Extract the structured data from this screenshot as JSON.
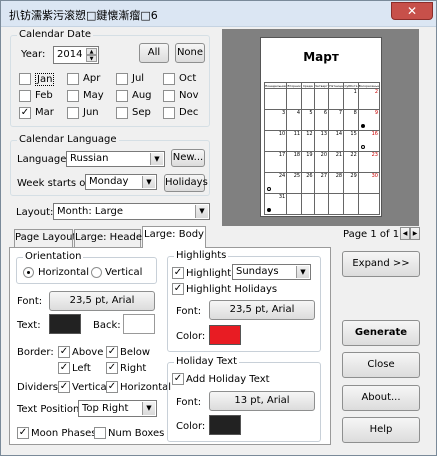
{
  "window": {
    "title": "扒钫濡紫污滚愬□鍵懐漸瘤□6",
    "close": "✕"
  },
  "calendar_date": {
    "group_label": "Calendar Date",
    "year_label": "Year:",
    "year_value": "2014",
    "all_label": "All",
    "none_label": "None",
    "months": [
      {
        "label": "Jan",
        "checked": false
      },
      {
        "label": "Apr",
        "checked": false
      },
      {
        "label": "Jul",
        "checked": false
      },
      {
        "label": "Oct",
        "checked": false
      },
      {
        "label": "Feb",
        "checked": false
      },
      {
        "label": "May",
        "checked": false
      },
      {
        "label": "Aug",
        "checked": false
      },
      {
        "label": "Nov",
        "checked": false
      },
      {
        "label": "Mar",
        "checked": true
      },
      {
        "label": "Jun",
        "checked": false
      },
      {
        "label": "Sep",
        "checked": false
      },
      {
        "label": "Dec",
        "checked": false
      }
    ]
  },
  "calendar_language": {
    "group_label": "Calendar Language",
    "language_label": "Language:",
    "language_value": "Russian",
    "new_label": "New...",
    "week_starts_label": "Week starts on:",
    "week_starts_value": "Monday",
    "holidays_label": "Holidays"
  },
  "layout": {
    "label": "Layout:",
    "value": "Month: Large"
  },
  "preview": {
    "month_title": "Март",
    "weekday_headers": [
      "Понедельник",
      "Вторник",
      "Среда",
      "Четверг",
      "Пятница",
      "Суббота",
      "Воскресенье"
    ],
    "weeks": [
      [
        "",
        "",
        "",
        "",
        "",
        "1",
        "2"
      ],
      [
        "3",
        "4",
        "5",
        "6",
        "7",
        "8",
        "9"
      ],
      [
        "10",
        "11",
        "12",
        "13",
        "14",
        "15",
        "16"
      ],
      [
        "17",
        "18",
        "19",
        "20",
        "21",
        "22",
        "23"
      ],
      [
        "24",
        "25",
        "26",
        "27",
        "28",
        "29",
        "30"
      ],
      [
        "31",
        "",
        "",
        "",
        "",
        "",
        ""
      ]
    ],
    "page_label": "Page 1 of 1",
    "prev_icon": "◀",
    "next_icon": "▶"
  },
  "tabs": [
    {
      "label": "Page Layout",
      "active": false
    },
    {
      "label": "Large: Header",
      "active": false
    },
    {
      "label": "Large: Body",
      "active": true
    }
  ],
  "orientation": {
    "group_label": "Orientation",
    "horizontal_label": "Horizontal",
    "vertical_label": "Vertical",
    "selected": "Horizontal"
  },
  "body": {
    "font_label": "Font:",
    "font_value": "23,5 pt, Arial",
    "text_label": "Text:",
    "text_color": "#222222",
    "back_label": "Back:",
    "back_color": "#ffffff",
    "border_label": "Border:",
    "border_above": "Above",
    "border_below": "Below",
    "border_left": "Left",
    "border_right": "Right",
    "dividers_label": "Dividers:",
    "dividers_vertical": "Vertical",
    "dividers_horizontal": "Horizontal",
    "text_position_label": "Text Position:",
    "text_position_value": "Top Right",
    "moon_phases": "Moon Phases",
    "num_boxes": "Num Boxes"
  },
  "highlights": {
    "group_label": "Highlights",
    "highlight_label": "Highlight:",
    "highlight_value": "Sundays",
    "highlight_holidays": "Highlight Holidays",
    "font_label": "Font:",
    "font_value": "23,5 pt, Arial",
    "color_label": "Color:",
    "color": "#e81c23"
  },
  "holiday_text": {
    "group_label": "Holiday Text",
    "add_label": "Add Holiday Text",
    "font_label": "Font:",
    "font_value": "13 pt, Arial",
    "color_label": "Color:",
    "color": "#222222"
  },
  "actions": {
    "expand": "Expand >>",
    "generate": "Generate",
    "close": "Close",
    "about": "About...",
    "help": "Help"
  },
  "icons": {
    "checkmark": "✓",
    "spin_up": "▲",
    "spin_down": "▼",
    "dropdown": "▼"
  }
}
